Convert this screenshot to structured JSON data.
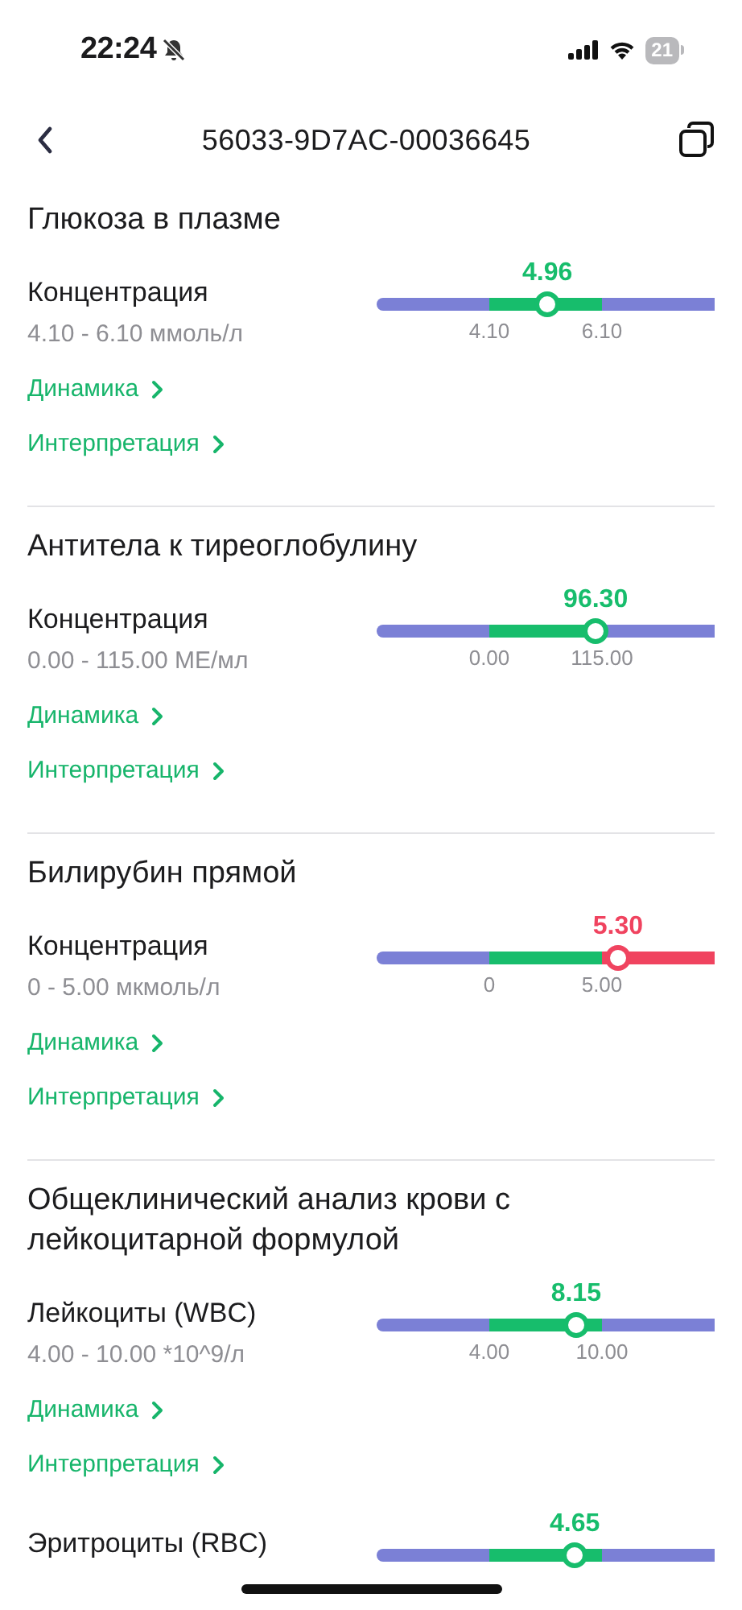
{
  "status_bar": {
    "time": "22:24",
    "battery": "21"
  },
  "header": {
    "title": "56033-9D7AC-00036645"
  },
  "sections": [
    {
      "title": "Глюкоза в плазме",
      "tests": [
        {
          "name": "Концентрация",
          "range": "4.10 - 6.10 ммоль/л",
          "value": "4.96",
          "out_of_range": false,
          "level": 0.505,
          "low": "4.10",
          "high": "6.10",
          "links": [
            "Динамика",
            "Интерпретация"
          ]
        }
      ]
    },
    {
      "title": "Антитела к тиреоглобулину",
      "tests": [
        {
          "name": "Концентрация",
          "range": "0.00 - 115.00 МЕ/мл",
          "value": "96.30",
          "out_of_range": false,
          "level": 0.648,
          "low": "0.00",
          "high": "115.00",
          "links": [
            "Динамика",
            "Интерпретация"
          ]
        }
      ]
    },
    {
      "title": "Билирубин прямой",
      "tests": [
        {
          "name": "Концентрация",
          "range": "0 - 5.00 мкмоль/л",
          "value": "5.30",
          "out_of_range": true,
          "level": 0.714,
          "low": "0",
          "high": "5.00",
          "links": [
            "Динамика",
            "Интерпретация"
          ]
        }
      ]
    },
    {
      "title": "Общеклинический анализ крови с лейкоцитарной формулой",
      "tests": [
        {
          "name": "Лейкоциты (WBC)",
          "range": "4.00 - 10.00 *10^9/л",
          "value": "8.15",
          "out_of_range": false,
          "level": 0.59,
          "low": "4.00",
          "high": "10.00",
          "links": [
            "Динамика",
            "Интерпретация"
          ]
        },
        {
          "name": "Эритроциты (RBC)",
          "value": "4.65",
          "out_of_range": false,
          "level": 0.586
        }
      ]
    }
  ]
}
